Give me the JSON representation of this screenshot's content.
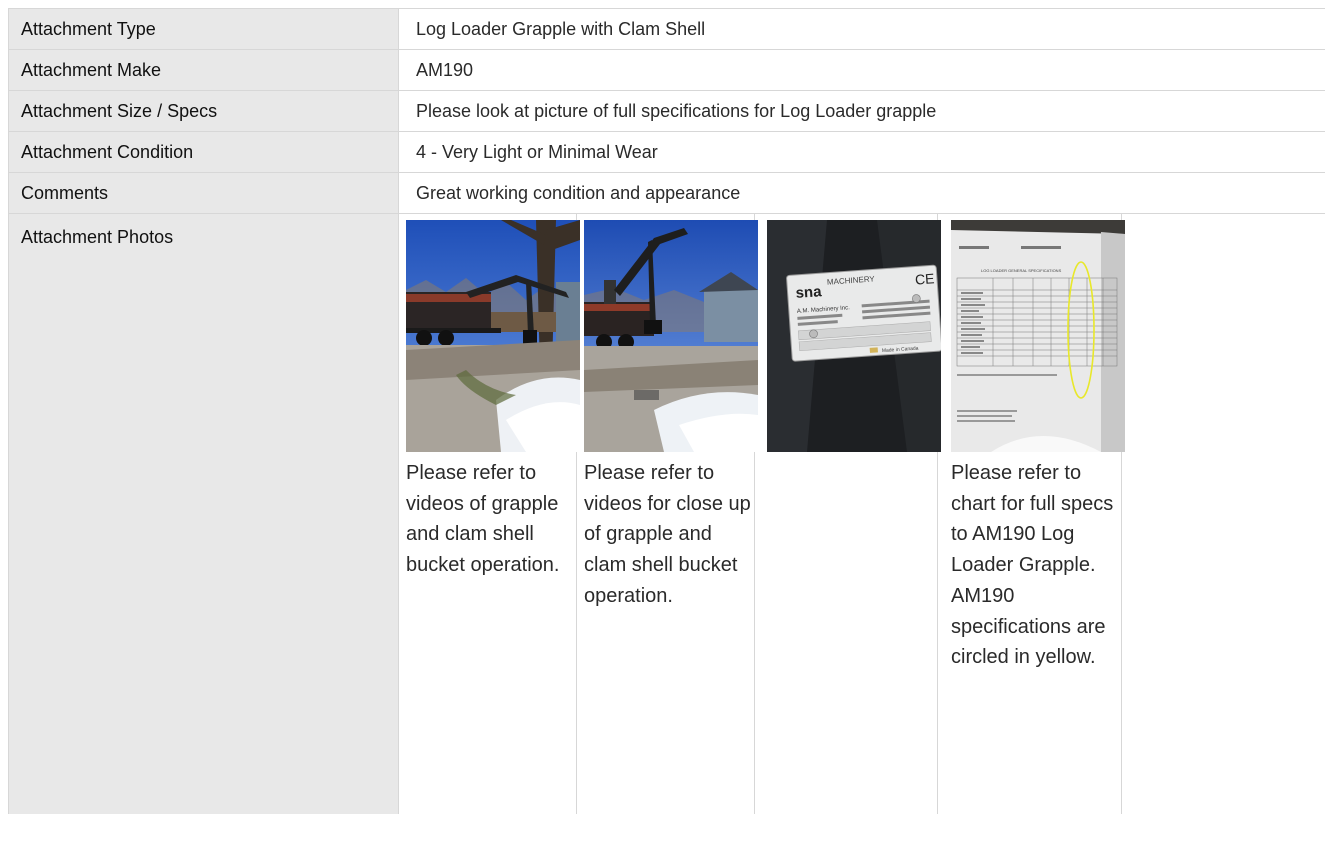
{
  "rows": [
    {
      "label": "Attachment Type",
      "value": "Log Loader Grapple with Clam Shell"
    },
    {
      "label": "Attachment Make",
      "value": "AM190"
    },
    {
      "label": "Attachment Size / Specs",
      "value": "Please look at picture of full specifications for Log Loader grapple"
    },
    {
      "label": "Attachment Condition",
      "value": "4 - Very Light or Minimal Wear"
    },
    {
      "label": "Comments",
      "value": "Great working condition and appearance"
    }
  ],
  "photos": {
    "label": "Attachment Photos",
    "items": [
      {
        "caption": "Please refer to videos of grapple and clam shell bucket operation."
      },
      {
        "caption": "Please refer to videos for close up of grapple and clam shell bucket operation."
      },
      {
        "caption": ""
      },
      {
        "caption": "Please refer to chart for full specs to AM190 Log Loader Grapple. AM190 specifications are circled in yellow."
      }
    ],
    "plate_text": {
      "brand": "sna",
      "maker": "MACHINERY",
      "company": "A.M. Machinery Inc.",
      "ce_mark": "CE",
      "origin": "Made in Canada"
    },
    "chart_doc_title": "LOG LOADER GENERAL SPECIFICATIONS"
  }
}
